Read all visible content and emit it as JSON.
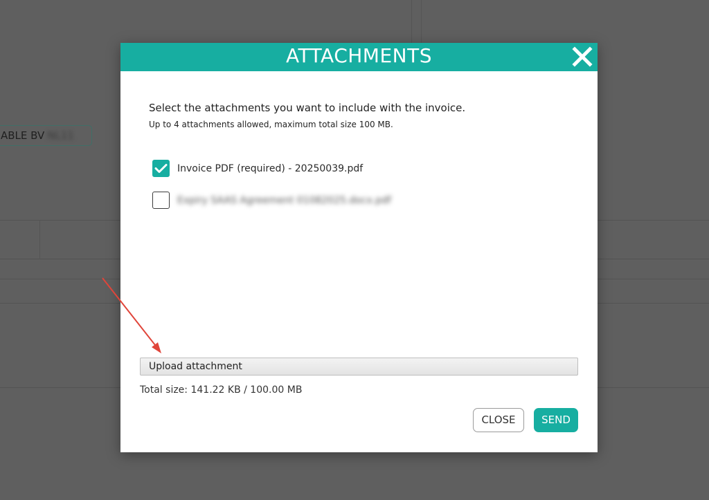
{
  "background": {
    "chip_label": "ABLE BV",
    "chip_hidden": "NL11"
  },
  "modal": {
    "title": "ATTACHMENTS",
    "intro": "Select the attachments you want to include with the invoice.",
    "sub_intro": "Up to 4 attachments allowed, maximum total size 100 MB.",
    "attachments": [
      {
        "label": "Invoice PDF (required) - 20250039.pdf",
        "checked": true
      },
      {
        "label": "Expiry SAAS Agreement 01082025.docx.pdf",
        "checked": false,
        "redacted": true
      }
    ],
    "upload_label": "Upload attachment",
    "total_size_label": "Total size:",
    "total_size_value": "141.22 KB / 100.00 MB",
    "close_label": "CLOSE",
    "send_label": "SEND"
  },
  "colors": {
    "accent": "#17aea1",
    "overlay": "#5f5f5f",
    "annotation_arrow": "#e0453a"
  },
  "icons": {
    "close": "close-x-icon",
    "checkmark": "check-icon"
  }
}
